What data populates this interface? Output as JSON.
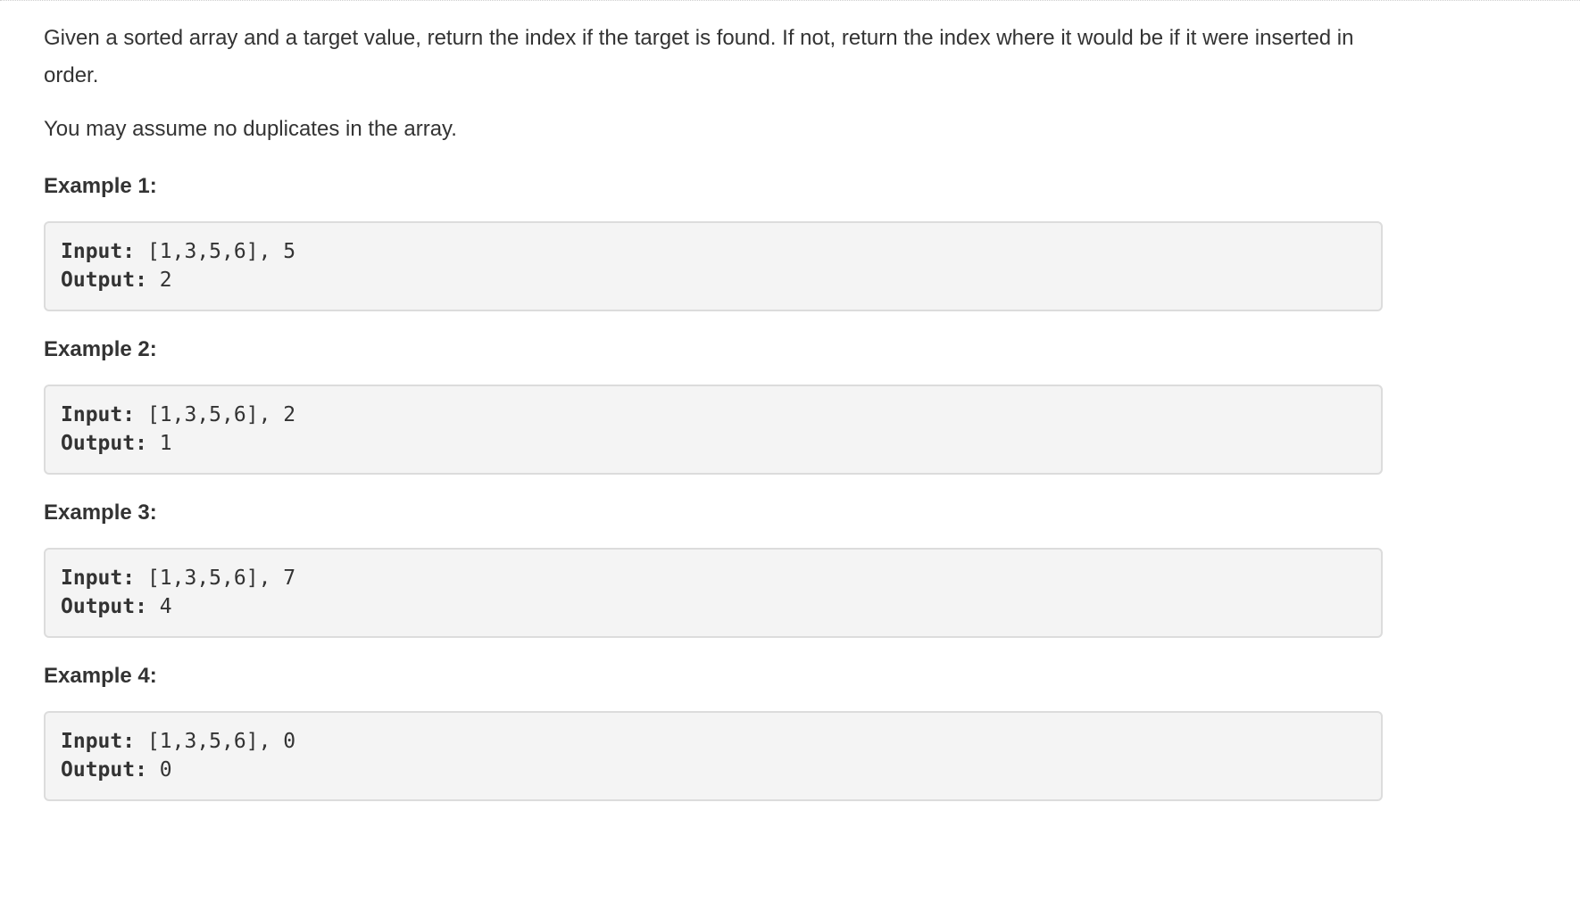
{
  "description": {
    "paragraph_1": "Given a sorted array and a target value, return the index if the target is found. If not, return the index where it would be if it were inserted in order.",
    "paragraph_2": "You may assume no duplicates in the array."
  },
  "examples": [
    {
      "heading": "Example 1:",
      "input_label": "Input:",
      "input_value": " [1,3,5,6], 5",
      "output_label": "Output:",
      "output_value": " 2"
    },
    {
      "heading": "Example 2:",
      "input_label": "Input:",
      "input_value": " [1,3,5,6], 2",
      "output_label": "Output:",
      "output_value": " 1"
    },
    {
      "heading": "Example 3:",
      "input_label": "Input:",
      "input_value": " [1,3,5,6], 7",
      "output_label": "Output:",
      "output_value": " 4"
    },
    {
      "heading": "Example 4:",
      "input_label": "Input:",
      "input_value": " [1,3,5,6], 0",
      "output_label": "Output:",
      "output_value": " 0"
    }
  ]
}
